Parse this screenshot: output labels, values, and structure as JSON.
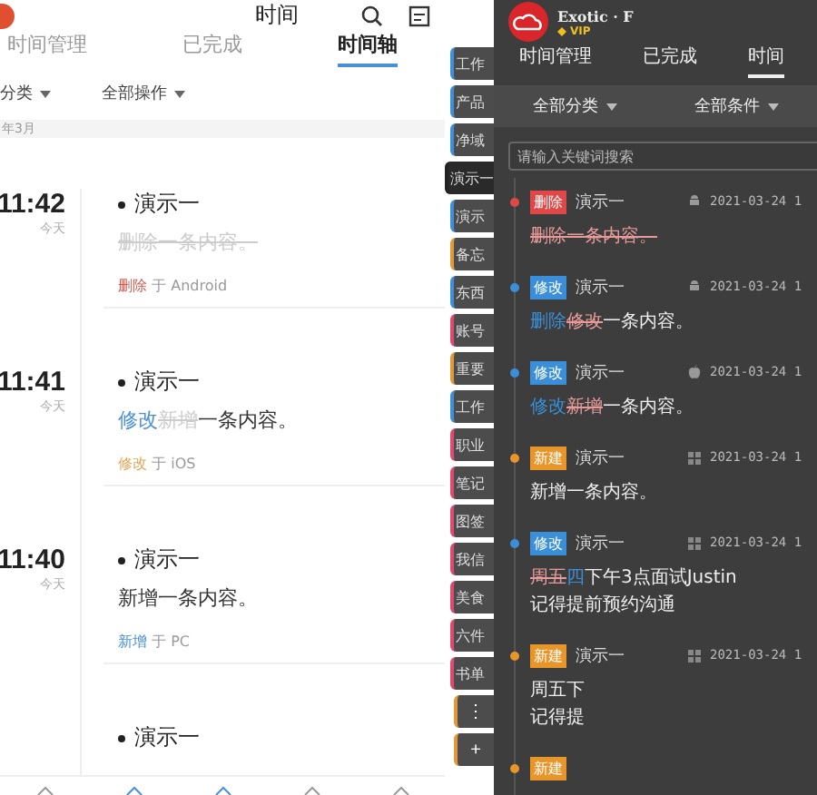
{
  "left": {
    "title": "时间",
    "tabs": [
      {
        "label": "时间管理",
        "selected": false
      },
      {
        "label": "已完成",
        "selected": false
      },
      {
        "label": "时间轴",
        "selected": true
      }
    ],
    "filters": [
      "分类",
      "全部操作"
    ],
    "month": "年3月",
    "entries": [
      {
        "time": "11:42",
        "day": "今天",
        "title": "演示一",
        "content": [
          {
            "kind": "strike",
            "text": "删除一条内容。"
          }
        ],
        "action": "删除",
        "color": "#d0584c",
        "via": "于 Android"
      },
      {
        "time": "11:41",
        "day": "今天",
        "title": "演示一",
        "content": [
          {
            "kind": "added",
            "text": "修改"
          },
          {
            "kind": "strike",
            "text": "新增"
          },
          {
            "kind": "plain",
            "text": "一条内容。"
          }
        ],
        "action": "修改",
        "color": "#e0a85a",
        "via": "于 iOS"
      },
      {
        "time": "11:40",
        "day": "今天",
        "title": "演示一",
        "content": [
          {
            "kind": "plain",
            "text": "新增一条内容。"
          }
        ],
        "action": "新增",
        "color": "#4a8fd8",
        "via": "于 PC"
      },
      {
        "title": "演示一"
      }
    ]
  },
  "notebooks": {
    "items": [
      {
        "label": "工作",
        "color": "#3f8fd8",
        "selected": false
      },
      {
        "label": "产品",
        "color": "#3f8fd8",
        "selected": false
      },
      {
        "label": "净域",
        "color": "#3f8fd8",
        "selected": false
      },
      {
        "label": "演示一",
        "color": "#222222",
        "selected": true
      },
      {
        "label": "演示",
        "color": "#3f8fd8",
        "selected": false
      },
      {
        "label": "备忘",
        "color": "#e0983a",
        "selected": false
      },
      {
        "label": "东西",
        "color": "#3f8fd8",
        "selected": false
      },
      {
        "label": "账号",
        "color": "#e04870",
        "selected": false
      },
      {
        "label": "重要",
        "color": "#e0983a",
        "selected": false
      },
      {
        "label": "工作",
        "color": "#3f8fd8",
        "selected": false
      },
      {
        "label": "职业",
        "color": "#e04870",
        "selected": false
      },
      {
        "label": "笔记",
        "color": "#e04870",
        "selected": false
      },
      {
        "label": "图签",
        "color": "#e04870",
        "selected": false
      },
      {
        "label": "我信",
        "color": "#e04870",
        "selected": false
      },
      {
        "label": "美食",
        "color": "#e04870",
        "selected": false
      },
      {
        "label": "六件",
        "color": "#e04870",
        "selected": false
      },
      {
        "label": "书单",
        "color": "#e04870",
        "selected": false
      }
    ],
    "more": "⋮",
    "add": "+"
  },
  "right": {
    "user": {
      "name": "Exotic · F",
      "badge": "VIP"
    },
    "tabs": [
      {
        "label": "时间管理",
        "selected": false
      },
      {
        "label": "已完成",
        "selected": false
      },
      {
        "label": "时间",
        "selected": true
      }
    ],
    "filters": [
      "全部分类",
      "全部条件"
    ],
    "search": {
      "placeholder": "请输入关键词搜索"
    },
    "entries": [
      {
        "tag": "删除",
        "color": "#e04848",
        "title": "演示一",
        "kind": "android",
        "date": "2021-03-24 1",
        "lines": [
          [
            {
              "kind": "strike",
              "text": "删除一条内容。"
            }
          ]
        ]
      },
      {
        "tag": "修改",
        "color": "#3a8fd8",
        "title": "演示一",
        "kind": "android",
        "date": "2021-03-24 1",
        "lines": [
          [
            {
              "kind": "added",
              "text": "删除"
            },
            {
              "kind": "strike",
              "text": "修改"
            },
            {
              "kind": "plain",
              "text": "一条内容。"
            }
          ]
        ]
      },
      {
        "tag": "修改",
        "color": "#3a8fd8",
        "title": "演示一",
        "kind": "apple",
        "date": "2021-03-24 1",
        "lines": [
          [
            {
              "kind": "added",
              "text": "修改"
            },
            {
              "kind": "strike",
              "text": "新增"
            },
            {
              "kind": "plain",
              "text": "一条内容。"
            }
          ]
        ]
      },
      {
        "tag": "新建",
        "color": "#e8962a",
        "title": "演示一",
        "kind": "windows",
        "date": "2021-03-24 1",
        "lines": [
          [
            {
              "kind": "plain",
              "text": "新增一条内容。"
            }
          ]
        ]
      },
      {
        "tag": "修改",
        "color": "#3a8fd8",
        "title": "演示一",
        "kind": "windows",
        "date": "2021-03-24 1",
        "lines": [
          [
            {
              "kind": "strike",
              "text": "周五"
            },
            {
              "kind": "added",
              "text": "四"
            },
            {
              "kind": "plain",
              "text": "下午3点面试Justin"
            }
          ],
          [
            {
              "kind": "plain",
              "text": "记得提前预约沟通"
            }
          ]
        ]
      },
      {
        "tag": "新建",
        "color": "#e8962a",
        "title": "演示一",
        "kind": "windows",
        "date": "2021-03-24 1",
        "lines": [
          [
            {
              "kind": "plain",
              "text": "周五下"
            }
          ],
          [
            {
              "kind": "plain",
              "text": "记得提"
            }
          ]
        ]
      },
      {
        "tag": "新建",
        "color": "#e8962a"
      }
    ]
  }
}
